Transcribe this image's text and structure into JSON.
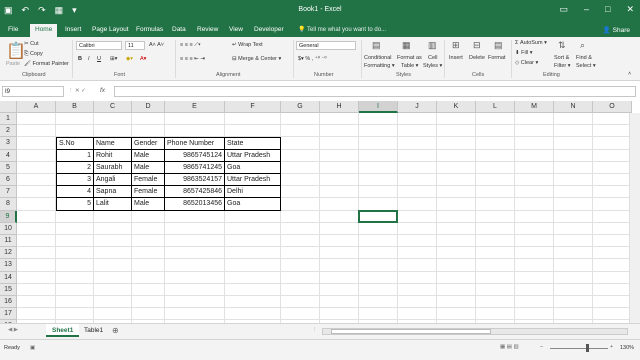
{
  "app": {
    "title": "Book1 - Excel"
  },
  "tabs": [
    "File",
    "Home",
    "Insert",
    "Page Layout",
    "Formulas",
    "Data",
    "Review",
    "View",
    "Developer"
  ],
  "tell_me": "Tell me what you want to do...",
  "share": "Share",
  "ribbon": {
    "clipboard": {
      "paste": "Paste",
      "cut": "Cut",
      "copy": "Copy",
      "format_painter": "Format Painter",
      "label": "Clipboard"
    },
    "font": {
      "name": "Calibri",
      "size": "11",
      "label": "Font"
    },
    "alignment": {
      "wrap": "Wrap Text",
      "merge": "Merge & Center",
      "label": "Alignment"
    },
    "number": {
      "format": "General",
      "label": "Number"
    },
    "styles": {
      "conditional": "Conditional",
      "formatting": "Formatting",
      "format_as": "Format as",
      "table": "Table",
      "cell": "Cell",
      "styles_word": "Styles",
      "label": "Styles"
    },
    "cells": {
      "insert": "Insert",
      "delete": "Delete",
      "format": "Format",
      "label": "Cells"
    },
    "editing": {
      "autosum": "AutoSum",
      "fill": "Fill",
      "clear": "Clear",
      "sort": "Sort &",
      "filter": "Filter",
      "find": "Find &",
      "select": "Select",
      "label": "Editing"
    }
  },
  "formula_bar": {
    "name_box": "I9",
    "fx": "fx",
    "value": ""
  },
  "columns": [
    "A",
    "B",
    "C",
    "D",
    "E",
    "F",
    "G",
    "H",
    "I",
    "J",
    "K",
    "L",
    "M",
    "N",
    "O"
  ],
  "rows": [
    "1",
    "2",
    "3",
    "4",
    "5",
    "6",
    "7",
    "8",
    "9",
    "10",
    "11",
    "12",
    "13",
    "14",
    "15",
    "16",
    "17",
    "18"
  ],
  "table": {
    "headers": [
      "S.No",
      "Name",
      "Gender",
      "Phone Number",
      "State"
    ],
    "rows": [
      [
        "1",
        "Rohit",
        "Male",
        "9865745124",
        "Uttar Pradesh"
      ],
      [
        "2",
        "Saurabh",
        "Male",
        "9865741245",
        "Goa"
      ],
      [
        "3",
        "Angali",
        "Female",
        "9863524157",
        "Uttar Pradesh"
      ],
      [
        "4",
        "Sapna",
        "Female",
        "8657425846",
        "Delhi"
      ],
      [
        "5",
        "Lalit",
        "Male",
        "8652013456",
        "Goa"
      ]
    ]
  },
  "sheets": [
    "Sheet1",
    "Table1"
  ],
  "status": {
    "ready": "Ready",
    "zoom": "130%"
  },
  "colors": {
    "accent": "#217346"
  }
}
